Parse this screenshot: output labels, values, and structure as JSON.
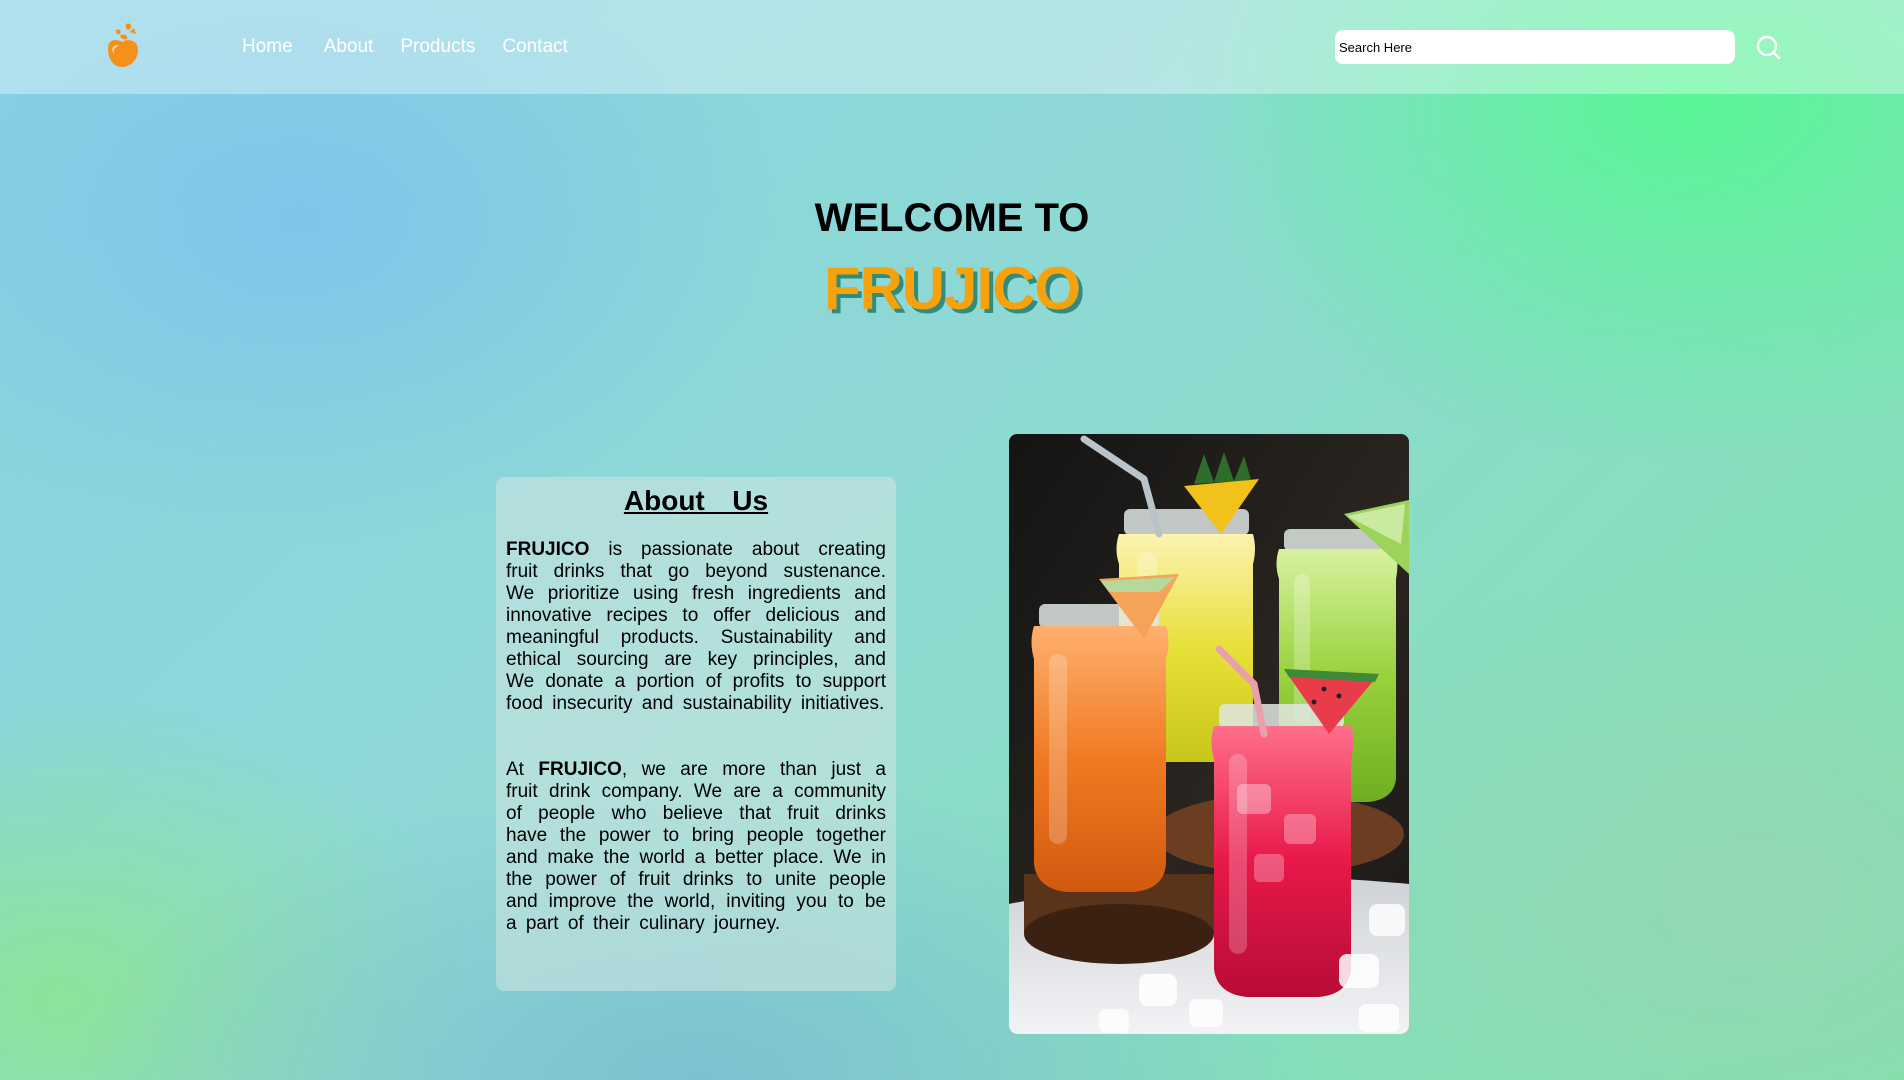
{
  "nav": {
    "links": [
      "Home",
      "About",
      "Products",
      "Contact"
    ]
  },
  "search": {
    "placeholder": "Search Here"
  },
  "hero": {
    "welcome": "WELCOME TO",
    "brand": "FRUJICO"
  },
  "about": {
    "title": "About  Us",
    "para1": {
      "brand": "FRUJICO",
      "text": " is passionate about creating fruit drinks that go beyond sustenance. We prioritize using fresh ingredients and innovative recipes to offer delicious and meaningful products. Sustainability and ethical sourcing are key principles, and We donate a portion of profits to support food insecurity and sustainability initiatives."
    },
    "para2": {
      "prefix": "At ",
      "brand": "FRUJICO",
      "text": ", we are more than just a fruit drink company. We are a community of people who believe that fruit drinks have the power to bring people together and make the world a better place. We in the power of fruit drinks to unite people and improve the world, inviting you to be a part of their culinary journey."
    }
  },
  "colors": {
    "brand": "#f5a20c",
    "brand_shadow": "#2f8c7e",
    "nav_text": "#ffffff"
  },
  "icons": {
    "logo": "fruit-logo-icon",
    "search": "search-icon"
  },
  "image": {
    "subject": "fruit-drink-jars-photo"
  }
}
